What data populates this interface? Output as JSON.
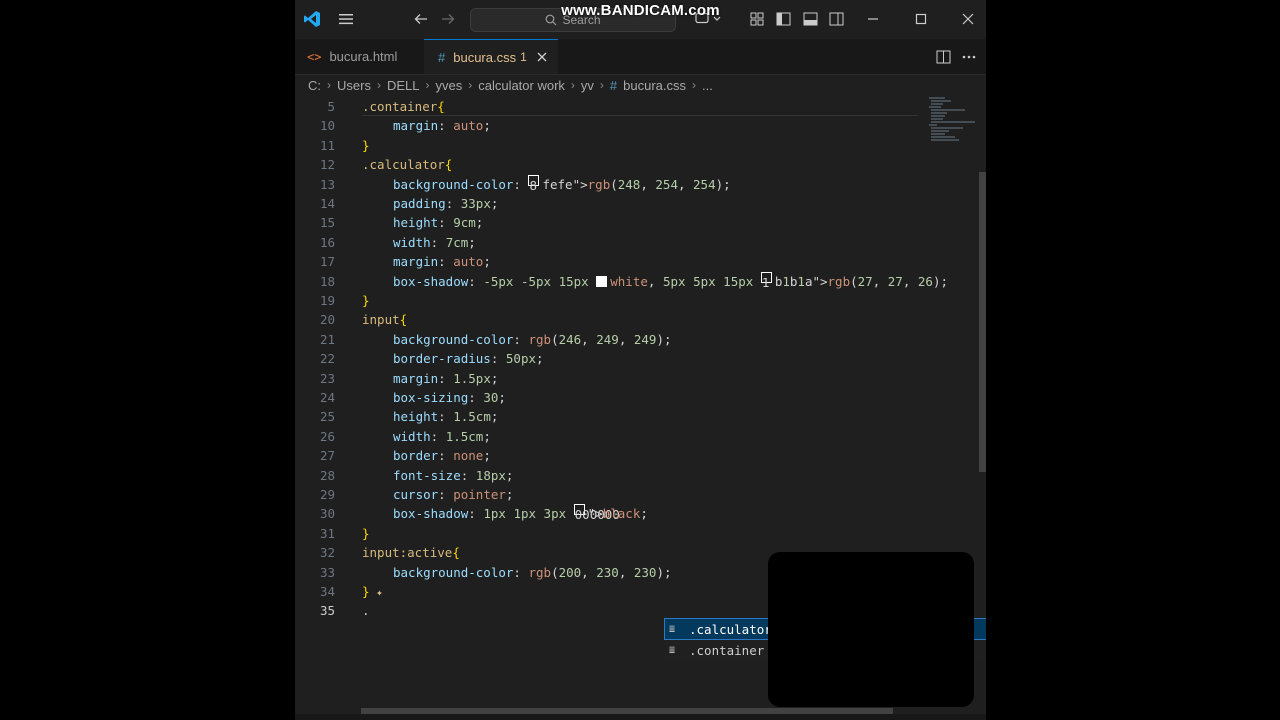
{
  "watermark": "www.BANDICAM.com",
  "search": {
    "placeholder": "Search"
  },
  "tabs": [
    {
      "label": "bucura.html",
      "icon": "html-icon"
    },
    {
      "label": "bucura.css",
      "badge": "1",
      "icon": "css-hash-icon"
    }
  ],
  "breadcrumb": [
    "C:",
    "Users",
    "DELL",
    "yves",
    "calculator work",
    "yv",
    "bucura.css",
    "..."
  ],
  "lines": [
    {
      "n": "5",
      "text": ".container{"
    },
    {
      "n": "10",
      "text": "margin: auto;"
    },
    {
      "n": "11",
      "text": "}"
    },
    {
      "n": "12",
      "text": ".calculator{"
    },
    {
      "n": "13",
      "text": "background-color: rgb(248, 254, 254);"
    },
    {
      "n": "14",
      "text": "padding: 33px;"
    },
    {
      "n": "15",
      "text": "height: 9cm;"
    },
    {
      "n": "16",
      "text": "width: 7cm;"
    },
    {
      "n": "17",
      "text": "margin: auto;"
    },
    {
      "n": "18",
      "text": "box-shadow: -5px -5px 15px white, 5px 5px 15px rgb(27, 27, 26);"
    },
    {
      "n": "19",
      "text": "}"
    },
    {
      "n": "20",
      "text": "input{"
    },
    {
      "n": "21",
      "text": "background-color: rgb(246, 249, 249);"
    },
    {
      "n": "22",
      "text": "border-radius: 50px;"
    },
    {
      "n": "23",
      "text": "margin: 1.5px;"
    },
    {
      "n": "24",
      "text": "box-sizing: 30;"
    },
    {
      "n": "25",
      "text": "height: 1.5cm;"
    },
    {
      "n": "26",
      "text": "width: 1.5cm;"
    },
    {
      "n": "27",
      "text": "border: none;"
    },
    {
      "n": "28",
      "text": "font-size: 18px;"
    },
    {
      "n": "29",
      "text": "cursor: pointer;"
    },
    {
      "n": "30",
      "text": "box-shadow: 1px 1px 3px black;"
    },
    {
      "n": "31",
      "text": "}"
    },
    {
      "n": "32",
      "text": "input:active{"
    },
    {
      "n": "33",
      "text": "background-color: rgb(200, 230, 230);"
    },
    {
      "n": "34",
      "text": "}"
    },
    {
      "n": "35",
      "text": "."
    }
  ],
  "swatch_colors": {
    "rgb_248_254_254": "#f8fefe",
    "white": "#ffffff",
    "rgb_27_27_26": "#1b1b1a",
    "rgb_246_249_249": "#f6f9f9",
    "black": "#000000",
    "rgb_200_230_230": "#c8e6e6"
  },
  "suggestions": [
    {
      "label": ".calculator",
      "selected": true
    },
    {
      "label": ".container",
      "selected": false
    }
  ],
  "colors": {
    "accent": "#0078d4",
    "tab_modified": "#e2c08d",
    "suggest_selected": "#04395e"
  }
}
